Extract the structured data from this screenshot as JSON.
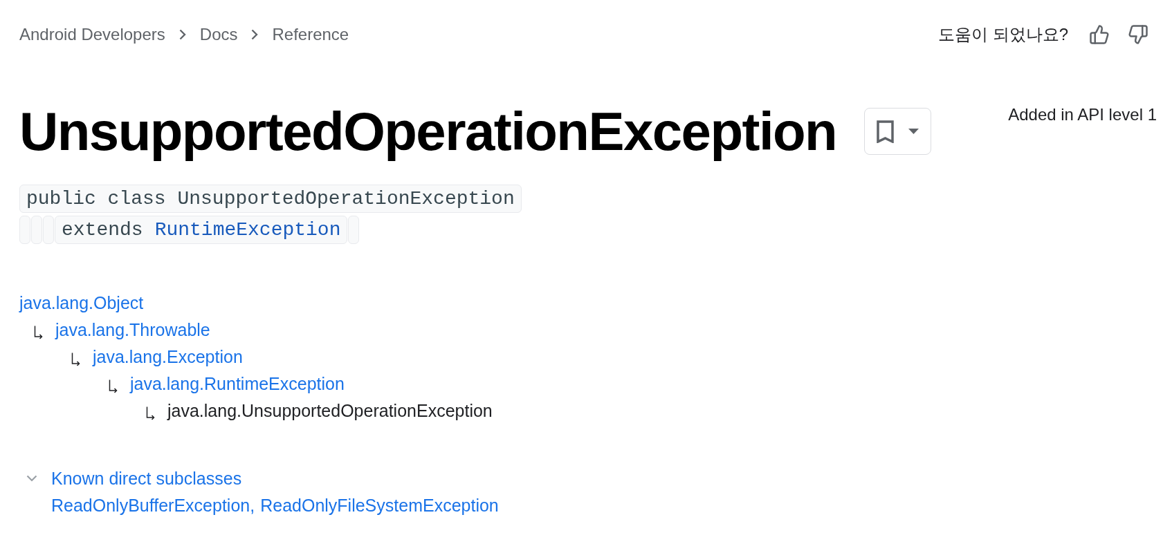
{
  "breadcrumb": [
    {
      "label": "Android Developers"
    },
    {
      "label": "Docs"
    },
    {
      "label": "Reference"
    }
  ],
  "feedback": {
    "prompt": "도움이 되었나요?"
  },
  "title": "UnsupportedOperationException",
  "api_level": "Added in API level 1",
  "declaration": [
    {
      "segments": [
        {
          "kind": "code",
          "parts": [
            {
              "text": "public class UnsupportedOperationException",
              "link": false
            }
          ]
        }
      ]
    },
    {
      "segments": [
        {
          "kind": "blank"
        },
        {
          "kind": "blank"
        },
        {
          "kind": "blank"
        },
        {
          "kind": "code",
          "parts": [
            {
              "text": "extends",
              "link": false
            },
            {
              "text": "RuntimeException",
              "link": true
            }
          ]
        },
        {
          "kind": "blank"
        }
      ]
    }
  ],
  "inheritance": {
    "label": "java.lang.Object",
    "link": true,
    "children": [
      {
        "label": "java.lang.Throwable",
        "link": true,
        "children": [
          {
            "label": "java.lang.Exception",
            "link": true,
            "children": [
              {
                "label": "java.lang.RuntimeException",
                "link": true,
                "children": [
                  {
                    "label": "java.lang.UnsupportedOperationException",
                    "link": false
                  }
                ]
              }
            ]
          }
        ]
      }
    ]
  },
  "subclasses": {
    "label": "Known direct subclasses",
    "expanded": true,
    "items": [
      {
        "label": "ReadOnlyBufferException",
        "separator": ","
      },
      {
        "label": "ReadOnlyFileSystemException"
      }
    ]
  }
}
